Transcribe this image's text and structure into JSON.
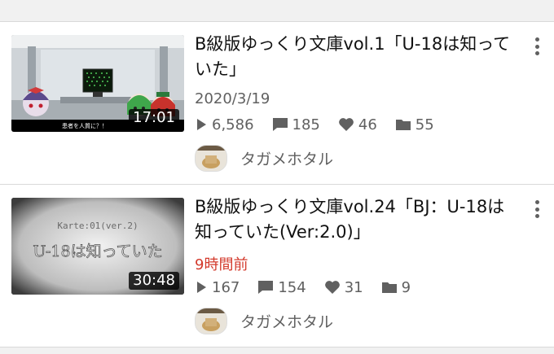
{
  "videos": [
    {
      "title": "B級版ゆっくり文庫vol.1「U-18は知っていた」",
      "duration": "17:01",
      "date": "2020/3/19",
      "views": "6,586",
      "comments": "185",
      "likes": "46",
      "playlists": "55",
      "channel": "タガメホタル",
      "thumb_caption": "患者を人質に？！"
    },
    {
      "title": "B級版ゆっくり文庫vol.24「BJ：U-18は知っていた(Ver:2.0)」",
      "duration": "30:48",
      "date": "9時間前",
      "views": "167",
      "comments": "154",
      "likes": "31",
      "playlists": "9",
      "channel": "タガメホタル",
      "thumb_line1": "Karte:01(ver.2)",
      "thumb_line2": "U-18は知っていた"
    }
  ],
  "colors": {
    "background": "#f1f1f1",
    "card": "#ffffff",
    "meta_text": "#606060",
    "recent_date": "#d33a2c"
  },
  "icons": [
    "play-icon",
    "comment-icon",
    "heart-icon",
    "folder-icon",
    "more-vert-icon"
  ]
}
